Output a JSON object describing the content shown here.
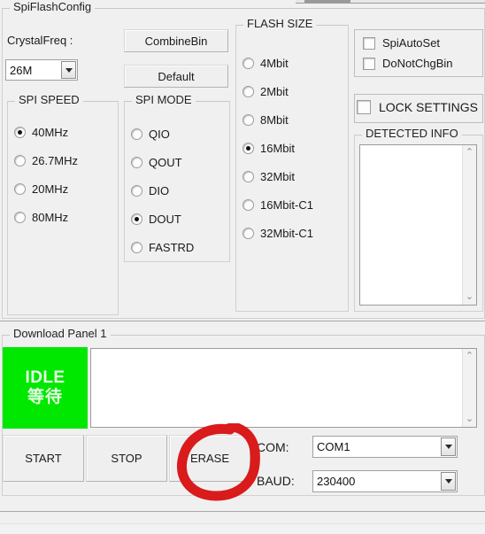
{
  "window": {
    "spiflash_group_title": "SpiFlashConfig",
    "download_group_title": "Download Panel 1"
  },
  "crystal": {
    "label": "CrystalFreq :",
    "value": "26M"
  },
  "actions": {
    "combine_bin": "CombineBin",
    "default": "Default"
  },
  "spi_speed": {
    "title": "SPI SPEED",
    "options": [
      {
        "label": "40MHz",
        "selected": true
      },
      {
        "label": "26.7MHz",
        "selected": false
      },
      {
        "label": "20MHz",
        "selected": false
      },
      {
        "label": "80MHz",
        "selected": false
      }
    ]
  },
  "spi_mode": {
    "title": "SPI MODE",
    "options": [
      {
        "label": "QIO",
        "selected": false
      },
      {
        "label": "QOUT",
        "selected": false
      },
      {
        "label": "DIO",
        "selected": false
      },
      {
        "label": "DOUT",
        "selected": true
      },
      {
        "label": "FASTRD",
        "selected": false
      }
    ]
  },
  "flash_size": {
    "title": "FLASH SIZE",
    "options": [
      {
        "label": "4Mbit",
        "selected": false
      },
      {
        "label": "2Mbit",
        "selected": false
      },
      {
        "label": "8Mbit",
        "selected": false
      },
      {
        "label": "16Mbit",
        "selected": true
      },
      {
        "label": "32Mbit",
        "selected": false
      },
      {
        "label": "16Mbit-C1",
        "selected": false
      },
      {
        "label": "32Mbit-C1",
        "selected": false
      }
    ]
  },
  "options_panel": {
    "spi_auto_set": {
      "label": "SpiAutoSet",
      "checked": false
    },
    "do_not_chg_bin": {
      "label": "DoNotChgBin",
      "checked": false
    },
    "lock_settings": {
      "label": "LOCK SETTINGS",
      "checked": false
    }
  },
  "detected_info": {
    "title": "DETECTED INFO",
    "content": "",
    "scroll_up_glyph": "⌃",
    "scroll_down_glyph": "⌄"
  },
  "download_panel": {
    "status_line1": "IDLE",
    "status_line2": "等待",
    "status_color": "#00e800",
    "log_content": "",
    "scroll_up_glyph": "⌃",
    "scroll_down_glyph": "⌄",
    "buttons": {
      "start": "START",
      "stop": "STOP",
      "erase": "ERASE"
    }
  },
  "serial": {
    "com_label": "COM:",
    "com_value": "COM1",
    "baud_label": "BAUD:",
    "baud_value": "230400"
  },
  "annotation": {
    "shape": "hand-drawn-red-ellipse",
    "target": "ERASE",
    "color": "#d91b1b"
  },
  "status_bar": {
    "text": ""
  }
}
